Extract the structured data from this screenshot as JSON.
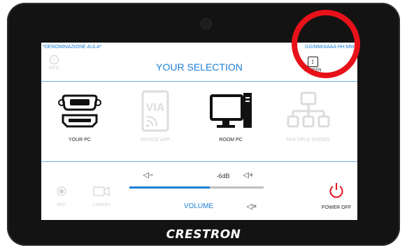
{
  "device": {
    "brand": "CRESTRON"
  },
  "header": {
    "room_name": "*DENOMINAZIONE AULA*",
    "datetime": "GG/MM/AAAA HH:MM*",
    "info_label": "INFO",
    "title": "YOUR SELECTION",
    "screen_label": "SCREEN"
  },
  "sources": [
    {
      "label": "YOUR PC",
      "icon": "vga-hdmi-icon",
      "enabled": true
    },
    {
      "label": "DEVICE APP",
      "icon": "via-device-icon",
      "enabled": false
    },
    {
      "label": "ROOM PC",
      "icon": "desktop-pc-icon",
      "enabled": true
    },
    {
      "label": "MULTIPLE ROOMS",
      "icon": "multiple-rooms-icon",
      "enabled": false
    }
  ],
  "audio": {
    "volume_down": "◁−",
    "volume_up": "◁+",
    "mute": "◁×",
    "level": "-6dB",
    "level_fraction": 0.6,
    "label": "VOLUME"
  },
  "controls": {
    "rec_label": "REC",
    "camera_label": "CAMERA",
    "power_label": "POWER OFF"
  },
  "colors": {
    "accent": "#1e7fd6",
    "power": "#e8111a",
    "annotation": "#e8111a"
  }
}
